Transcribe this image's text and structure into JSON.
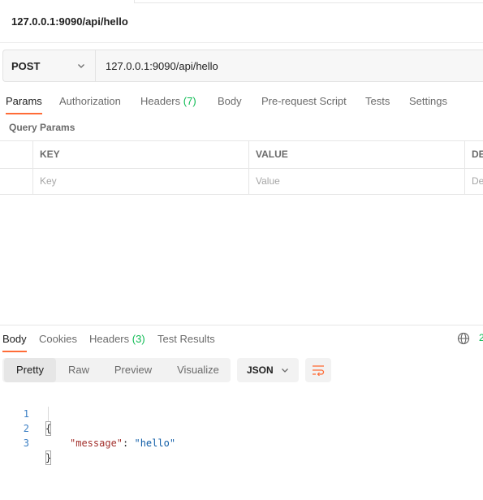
{
  "request": {
    "title": "127.0.0.1:9090/api/hello",
    "method": "POST",
    "url": "127.0.0.1:9090/api/hello"
  },
  "request_tabs": [
    {
      "label": "Params",
      "active": true
    },
    {
      "label": "Authorization"
    },
    {
      "label": "Headers",
      "count": "(7)"
    },
    {
      "label": "Body"
    },
    {
      "label": "Pre-request Script"
    },
    {
      "label": "Tests"
    },
    {
      "label": "Settings"
    }
  ],
  "query_params": {
    "title": "Query Params",
    "headers": [
      "KEY",
      "VALUE",
      "DE"
    ],
    "placeholders": {
      "key": "Key",
      "value": "Value",
      "desc": "De"
    }
  },
  "response": {
    "tabs": [
      {
        "label": "Body",
        "active": true
      },
      {
        "label": "Cookies"
      },
      {
        "label": "Headers",
        "count": "(3)"
      },
      {
        "label": "Test Results"
      }
    ],
    "status_partial": "2",
    "view_modes": [
      "Pretty",
      "Raw",
      "Preview",
      "Visualize"
    ],
    "active_view": "Pretty",
    "format": "JSON",
    "lines": [
      {
        "num": "1",
        "text": "{"
      },
      {
        "num": "2",
        "key": "\"message\"",
        "sep": ": ",
        "value": "\"hello\""
      },
      {
        "num": "3",
        "text": "}"
      }
    ]
  },
  "colors": {
    "accent": "#ff6c37",
    "count_green": "#0cbb52",
    "json_key": "#a3312d",
    "json_string": "#0f5da7",
    "line_number": "#3b7fc4"
  },
  "icons": [
    "chevron-down-icon",
    "globe-icon",
    "wrap-lines-icon"
  ]
}
